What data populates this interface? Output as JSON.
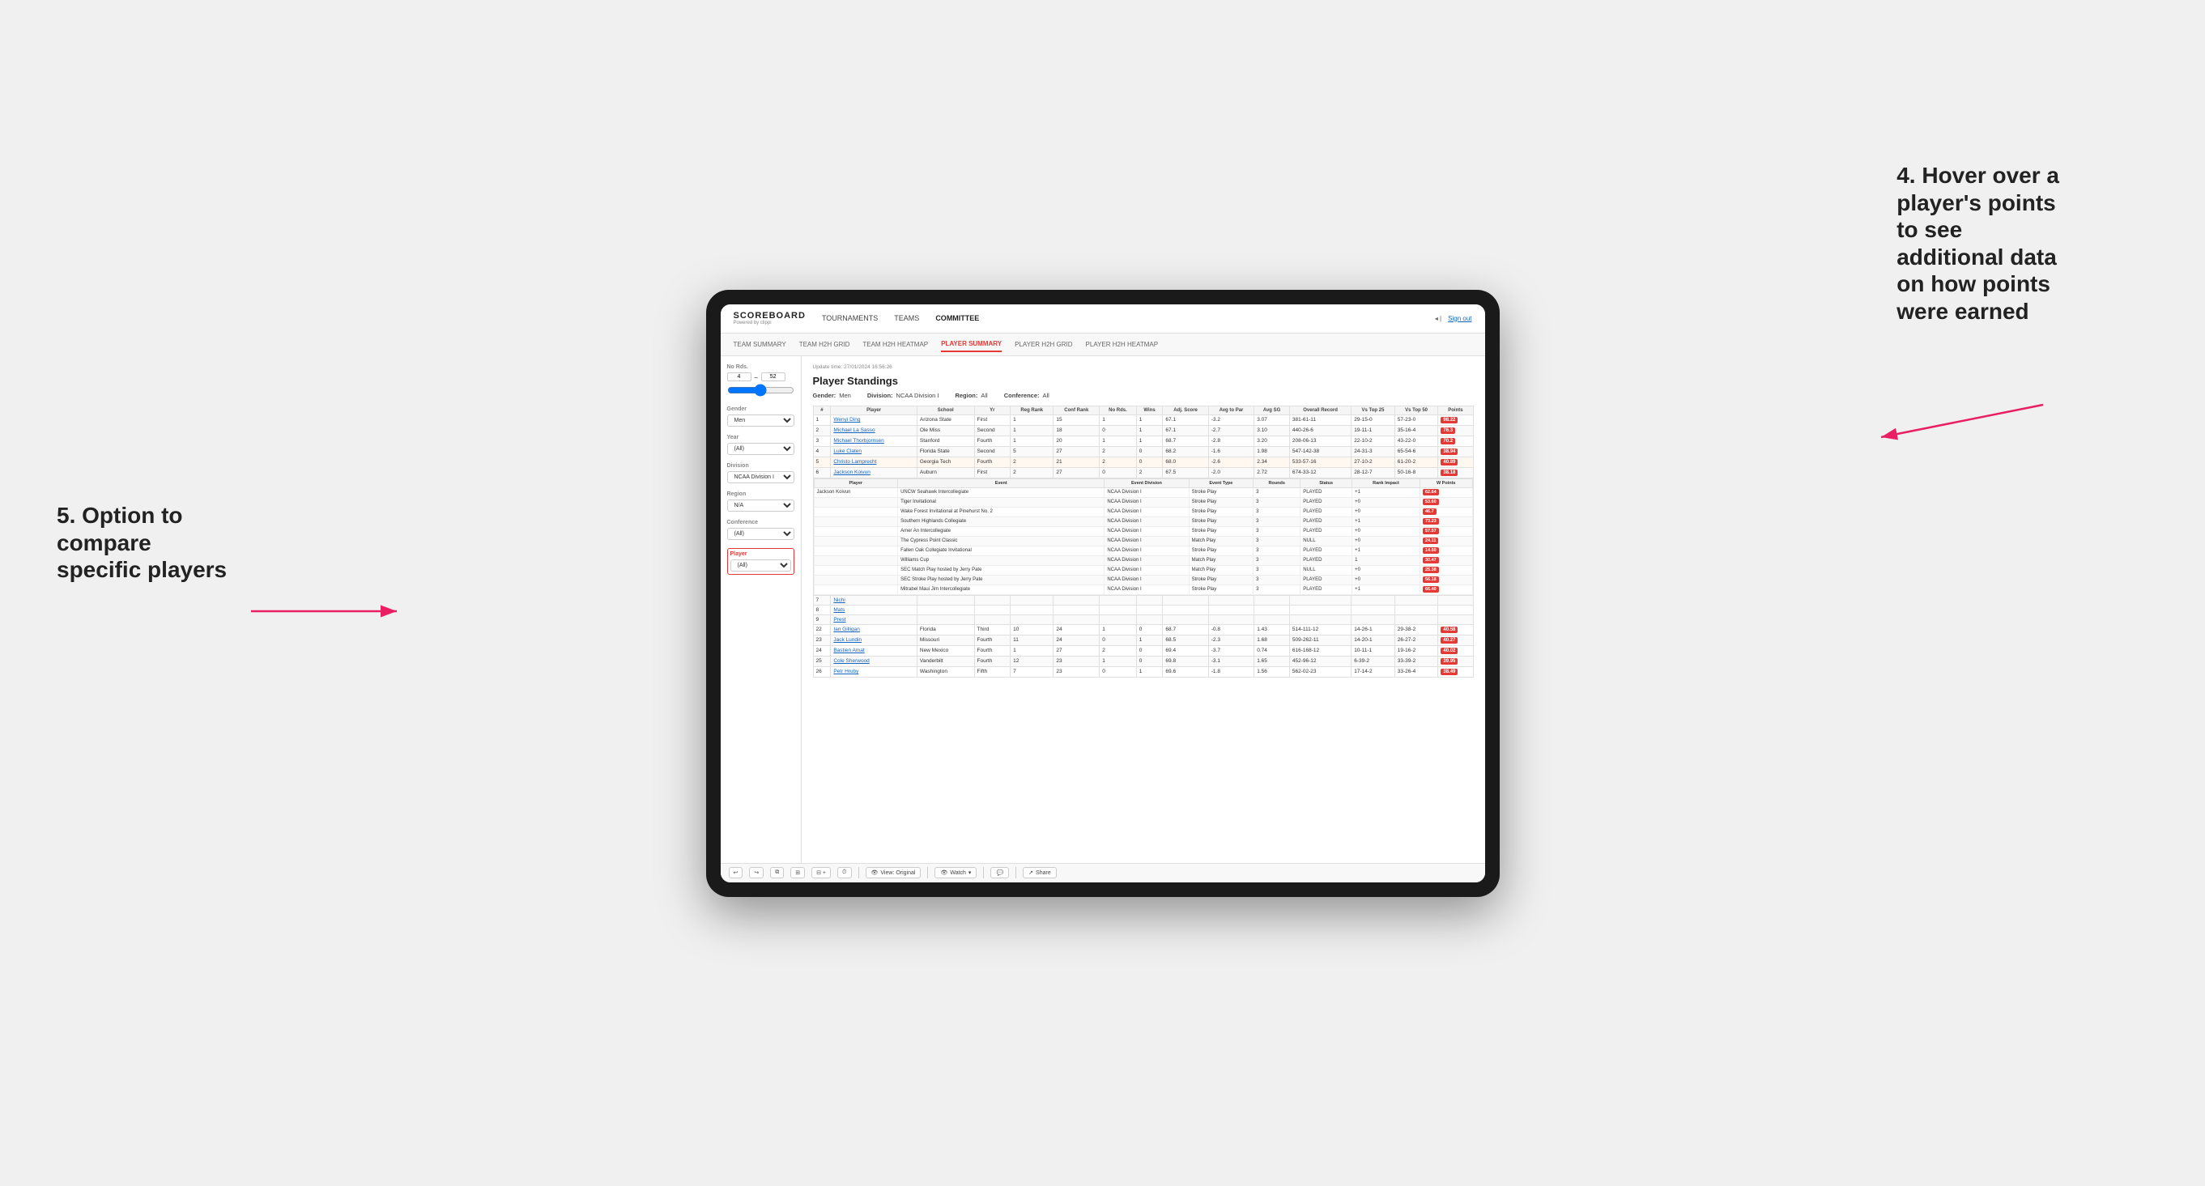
{
  "annotations": {
    "note4_title": "4. Hover over a",
    "note4_line1": "player's points",
    "note4_line2": "to see",
    "note4_line3": "additional data",
    "note4_line4": "on how points",
    "note4_line5": "were earned",
    "note5_title": "5. Option to",
    "note5_line1": "compare",
    "note5_line2": "specific players"
  },
  "app": {
    "logo": "SCOREBOARD",
    "logo_sub": "Powered by clippi",
    "sign_out": "Sign out"
  },
  "nav": {
    "items": [
      {
        "label": "TOURNAMENTS",
        "active": false
      },
      {
        "label": "TEAMS",
        "active": false
      },
      {
        "label": "COMMITTEE",
        "active": true
      }
    ]
  },
  "subnav": {
    "items": [
      {
        "label": "TEAM SUMMARY",
        "active": false
      },
      {
        "label": "TEAM H2H GRID",
        "active": false
      },
      {
        "label": "TEAM H2H HEATMAP",
        "active": false
      },
      {
        "label": "PLAYER SUMMARY",
        "active": true
      },
      {
        "label": "PLAYER H2H GRID",
        "active": false
      },
      {
        "label": "PLAYER H2H HEATMAP",
        "active": false
      }
    ]
  },
  "sidebar": {
    "no_rds_label": "No Rds.",
    "range_min": "4",
    "range_max": "52",
    "gender_label": "Gender",
    "gender_value": "Men",
    "year_label": "Year",
    "year_value": "(All)",
    "division_label": "Division",
    "division_value": "NCAA Division I",
    "region_label": "Region",
    "region_value": "N/A",
    "conference_label": "Conference",
    "conference_value": "(All)",
    "player_label": "Player",
    "player_value": "(All)"
  },
  "content": {
    "update_time": "Update time: 27/01/2024 16:56:26",
    "title": "Player Standings",
    "gender": "Men",
    "division": "NCAA Division I",
    "region": "All",
    "conference": "All",
    "table_headers": [
      "#",
      "Player",
      "School",
      "Yr",
      "Reg Rank",
      "Conf Rank",
      "No Rds.",
      "Wins",
      "Adj. Score",
      "Avg to Par",
      "Avg SG",
      "Overall Record",
      "Vs Top 25",
      "Vs Top 50",
      "Points"
    ],
    "players": [
      {
        "rank": 1,
        "name": "Wenyi Ding",
        "school": "Arizona State",
        "yr": "First",
        "reg_rank": 1,
        "conf_rank": 15,
        "rds": 1,
        "wins": 1,
        "adj_score": 67.1,
        "to_par": -3.2,
        "avg_sg": 3.07,
        "overall": "381-61-11",
        "vs25": "29-15-0",
        "vs50": "57-23-0",
        "points": "98.22",
        "highlight": true
      },
      {
        "rank": 2,
        "name": "Michael La Sasso",
        "school": "Ole Miss",
        "yr": "Second",
        "reg_rank": 1,
        "conf_rank": 18,
        "rds": 0,
        "wins": 1,
        "adj_score": 67.1,
        "to_par": -2.7,
        "avg_sg": 3.1,
        "overall": "440-26-6",
        "vs25": "19-11-1",
        "vs50": "35-16-4",
        "points": "76.3"
      },
      {
        "rank": 3,
        "name": "Michael Thorbjornsen",
        "school": "Stanford",
        "yr": "Fourth",
        "reg_rank": 1,
        "conf_rank": 20,
        "rds": 1,
        "wins": 1,
        "adj_score": 68.7,
        "to_par": -2.8,
        "avg_sg": 3.2,
        "overall": "208-06-13",
        "vs25": "22-10-2",
        "vs50": "43-22-0",
        "points": "70.2"
      },
      {
        "rank": 4,
        "name": "Luke Claten",
        "school": "Florida State",
        "yr": "Second",
        "reg_rank": 5,
        "conf_rank": 27,
        "rds": 2,
        "wins": 0,
        "adj_score": 68.2,
        "to_par": -1.6,
        "avg_sg": 1.98,
        "overall": "547-142-38",
        "vs25": "24-31-3",
        "vs50": "65-54-6",
        "points": "38.94"
      },
      {
        "rank": 5,
        "name": "Christo Lamprecht",
        "school": "Georgia Tech",
        "yr": "Fourth",
        "reg_rank": 2,
        "conf_rank": 21,
        "rds": 2,
        "wins": 0,
        "adj_score": 68.0,
        "to_par": -2.6,
        "avg_sg": 2.34,
        "overall": "533-57-16",
        "vs25": "27-10-2",
        "vs50": "61-20-2",
        "points": "40.89"
      },
      {
        "rank": 6,
        "name": "Jackson Koivun",
        "school": "Auburn",
        "yr": "First",
        "reg_rank": 2,
        "conf_rank": 27,
        "rds": 0,
        "wins": 2,
        "adj_score": 67.5,
        "to_par": -2.0,
        "avg_sg": 2.72,
        "overall": "674-33-12",
        "vs25": "28-12-7",
        "vs50": "50-16-8",
        "points": "38.18"
      },
      {
        "rank": 7,
        "name": "Nichi",
        "school": "",
        "yr": "",
        "reg_rank": "",
        "conf_rank": "",
        "rds": "",
        "wins": "",
        "adj_score": "",
        "to_par": "",
        "avg_sg": "",
        "overall": "",
        "vs25": "",
        "vs50": "",
        "points": ""
      },
      {
        "rank": 8,
        "name": "Mats",
        "school": "",
        "yr": "",
        "reg_rank": "",
        "conf_rank": "",
        "rds": "",
        "wins": "",
        "adj_score": "",
        "to_par": "",
        "avg_sg": "",
        "overall": "",
        "vs25": "",
        "vs50": "",
        "points": ""
      },
      {
        "rank": 9,
        "name": "Prest",
        "school": "",
        "yr": "",
        "reg_rank": "",
        "conf_rank": "",
        "rds": "",
        "wins": "",
        "adj_score": "",
        "to_par": "",
        "avg_sg": "",
        "overall": "",
        "vs25": "",
        "vs50": "",
        "points": ""
      }
    ],
    "jackson_events": [
      {
        "player": "Jackson Koivun",
        "event": "UNCW Seahawk Intercollegiate",
        "division": "NCAA Division I",
        "type": "Stroke Play",
        "rounds": 3,
        "status": "PLAYED",
        "rank_impact": "+1",
        "points": "62.64"
      },
      {
        "player": "",
        "event": "Tiger Invitational",
        "division": "NCAA Division I",
        "type": "Stroke Play",
        "rounds": 3,
        "status": "PLAYED",
        "rank_impact": "+0",
        "points": "53.60"
      },
      {
        "player": "",
        "event": "Wake Forest Invitational at Pinehurst No. 2",
        "division": "NCAA Division I",
        "type": "Stroke Play",
        "rounds": 3,
        "status": "PLAYED",
        "rank_impact": "+0",
        "points": "40.7"
      },
      {
        "player": "",
        "event": "Southern Highlands Collegiate",
        "division": "NCAA Division I",
        "type": "Stroke Play",
        "rounds": 3,
        "status": "PLAYED",
        "rank_impact": "+1",
        "points": "73.23"
      },
      {
        "player": "",
        "event": "Amer An Intercollegiate",
        "division": "NCAA Division I",
        "type": "Stroke Play",
        "rounds": 3,
        "status": "PLAYED",
        "rank_impact": "+0",
        "points": "57.57"
      },
      {
        "player": "",
        "event": "The Cypress Point Classic",
        "division": "NCAA Division I",
        "type": "Match Play",
        "rounds": 3,
        "status": "NULL",
        "rank_impact": "+0",
        "points": "24.11"
      },
      {
        "player": "",
        "event": "Fallen Oak Collegiate Invitational",
        "division": "NCAA Division I",
        "type": "Stroke Play",
        "rounds": 3,
        "status": "PLAYED",
        "rank_impact": "+1",
        "points": "14.50"
      },
      {
        "player": "",
        "event": "Williams Cup",
        "division": "NCAA Division I",
        "type": "Match Play",
        "rounds": 3,
        "status": "PLAYED",
        "rank_impact": "1",
        "points": "30.47"
      },
      {
        "player": "",
        "event": "SEC Match Play hosted by Jerry Pate",
        "division": "NCAA Division I",
        "type": "Match Play",
        "rounds": 3,
        "status": "NULL",
        "rank_impact": "+0",
        "points": "25.38"
      },
      {
        "player": "",
        "event": "SEC Stroke Play hosted by Jerry Pate",
        "division": "NCAA Division I",
        "type": "Stroke Play",
        "rounds": 3,
        "status": "PLAYED",
        "rank_impact": "+0",
        "points": "56.18"
      },
      {
        "player": "",
        "event": "Mitrabel Maui Jim Intercollegiate",
        "division": "NCAA Division I",
        "type": "Stroke Play",
        "rounds": 3,
        "status": "PLAYED",
        "rank_impact": "+1",
        "points": "66.40"
      }
    ],
    "more_players": [
      {
        "rank": 22,
        "name": "Ian Gilligan",
        "school": "Florida",
        "yr": "Third",
        "reg_rank": 10,
        "conf_rank": 24,
        "rds": 1,
        "wins": 0,
        "adj_score": 68.7,
        "to_par": -0.8,
        "avg_sg": 1.43,
        "overall": "514-111-12",
        "vs25": "14-26-1",
        "vs50": "29-38-2",
        "points": "40.58"
      },
      {
        "rank": 23,
        "name": "Jack Lundin",
        "school": "Missouri",
        "yr": "Fourth",
        "reg_rank": 11,
        "conf_rank": 24,
        "rds": 0,
        "wins": 1,
        "adj_score": 68.5,
        "to_par": -2.3,
        "avg_sg": 1.68,
        "overall": "509-262-11",
        "vs25": "14-20-1",
        "vs50": "26-27-2",
        "points": "40.27"
      },
      {
        "rank": 24,
        "name": "Bastien Amat",
        "school": "New Mexico",
        "yr": "Fourth",
        "reg_rank": 1,
        "conf_rank": 27,
        "rds": 2,
        "wins": 0,
        "adj_score": 69.4,
        "to_par": -3.7,
        "avg_sg": 0.74,
        "overall": "616-168-12",
        "vs25": "10-11-1",
        "vs50": "19-16-2",
        "points": "40.02"
      },
      {
        "rank": 25,
        "name": "Cole Sherwood",
        "school": "Vanderbilt",
        "yr": "Fourth",
        "reg_rank": 12,
        "conf_rank": 23,
        "rds": 1,
        "wins": 0,
        "adj_score": 69.8,
        "to_par": -3.1,
        "avg_sg": 1.65,
        "overall": "452-96-12",
        "vs25": "6-39-2",
        "vs50": "33-39-2",
        "points": "39.95"
      },
      {
        "rank": 26,
        "name": "Petr Hruby",
        "school": "Washington",
        "yr": "Fifth",
        "reg_rank": 7,
        "conf_rank": 23,
        "rds": 0,
        "wins": 1,
        "adj_score": 69.6,
        "to_par": -1.8,
        "avg_sg": 1.56,
        "overall": "562-02-23",
        "vs25": "17-14-2",
        "vs50": "33-26-4",
        "points": "38.49"
      }
    ]
  },
  "toolbar": {
    "view_label": "View: Original",
    "watch_label": "Watch",
    "share_label": "Share"
  }
}
